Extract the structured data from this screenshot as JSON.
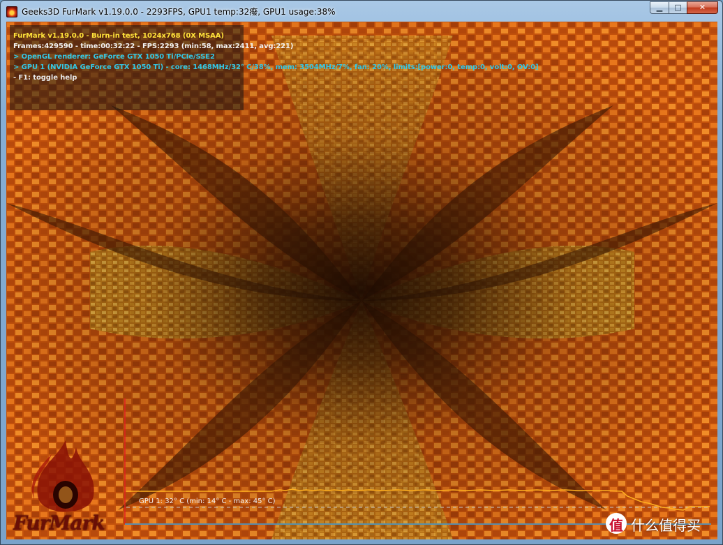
{
  "window": {
    "title": "Geeks3D FurMark v1.19.0.0 - 2293FPS, GPU1 temp:32癈, GPU1 usage:38%",
    "buttons": {
      "minimize": "▁",
      "maximize": "□",
      "close": "✕"
    }
  },
  "hud": {
    "line1": "FurMark v1.19.0.0 - Burn-in test, 1024x768 (0X MSAA)",
    "line2": "Frames:429590 - time:00:32:22 - FPS:2293 (min:58, max:2411, avg:221)",
    "line3": "> OpenGL renderer: GeForce GTX 1050 Ti/PCIe/SSE2",
    "line4": "> GPU 1 (NVIDIA GeForce GTX 1050 Ti) - core: 1468MHz/32° C/38%, mem: 3504MHz/7%, fan: 20%, limits:[power:0, temp:0, volt:0, OV:0]",
    "line5": "- F1: toggle help"
  },
  "temp_graph": {
    "label": "GPU 1: 32° C (min: 14° C - max: 45° C)",
    "colors": {
      "curve": "#ffb020",
      "axis_v": "#e02020",
      "axis_h": "#3aa0e0",
      "dashed": "#c8c8c8"
    }
  },
  "logo": {
    "text": "FurMark"
  },
  "watermark": {
    "badge": "值",
    "text": "什么值得买"
  },
  "colors": {
    "hud_title": "#ffe33a",
    "hud_info": "#33c8e6",
    "render_dark": "#2a1203",
    "render_orange": "#e06010",
    "render_gold": "#d8a020"
  }
}
